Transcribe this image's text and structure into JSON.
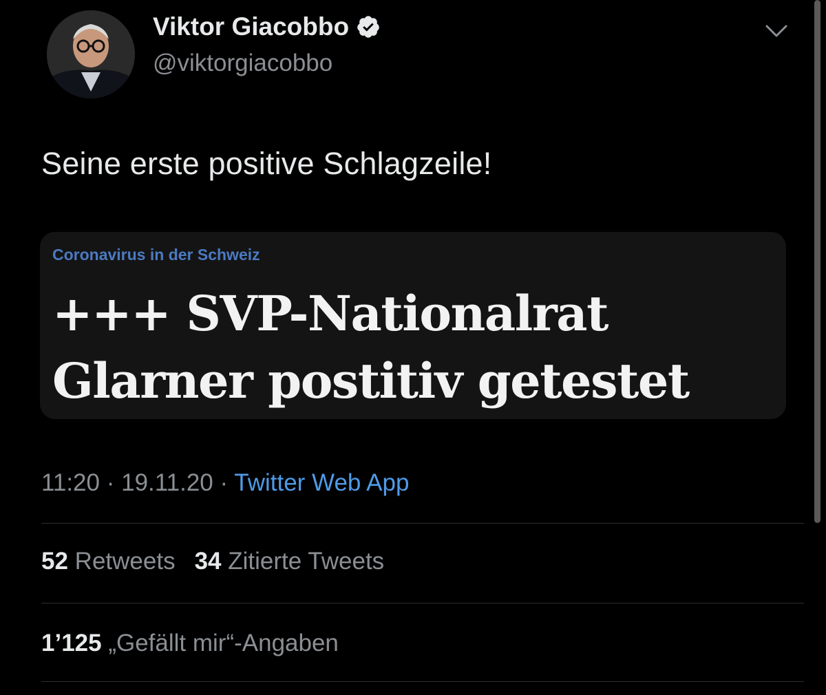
{
  "author": {
    "display_name": "Viktor Giacobbo",
    "handle": "@viktorgiacobbo",
    "verified_icon": "verified-badge-icon"
  },
  "menu": {
    "icon": "chevron-down-icon"
  },
  "tweet": {
    "text": "Seine erste positive Schlagzeile!"
  },
  "card": {
    "kicker": "Coronavirus in der Schweiz",
    "headline": "+++ SVP-Nationalrat Glarner postitiv getestet"
  },
  "meta": {
    "time": "11:20",
    "separator_1": " · ",
    "date": "19.11.20",
    "separator_2": " · ",
    "source": "Twitter Web App"
  },
  "stats": {
    "retweets_count": "52",
    "retweets_label": "Retweets",
    "quotes_count": "34",
    "quotes_label": "Zitierte Tweets",
    "likes_count": "1’125",
    "likes_label": "„Gefällt mir“-Angaben"
  },
  "colors": {
    "background": "#000000",
    "text_primary": "#e7e9ea",
    "text_secondary": "#8b8f93",
    "link": "#4f9be8",
    "card_background": "#141414"
  }
}
